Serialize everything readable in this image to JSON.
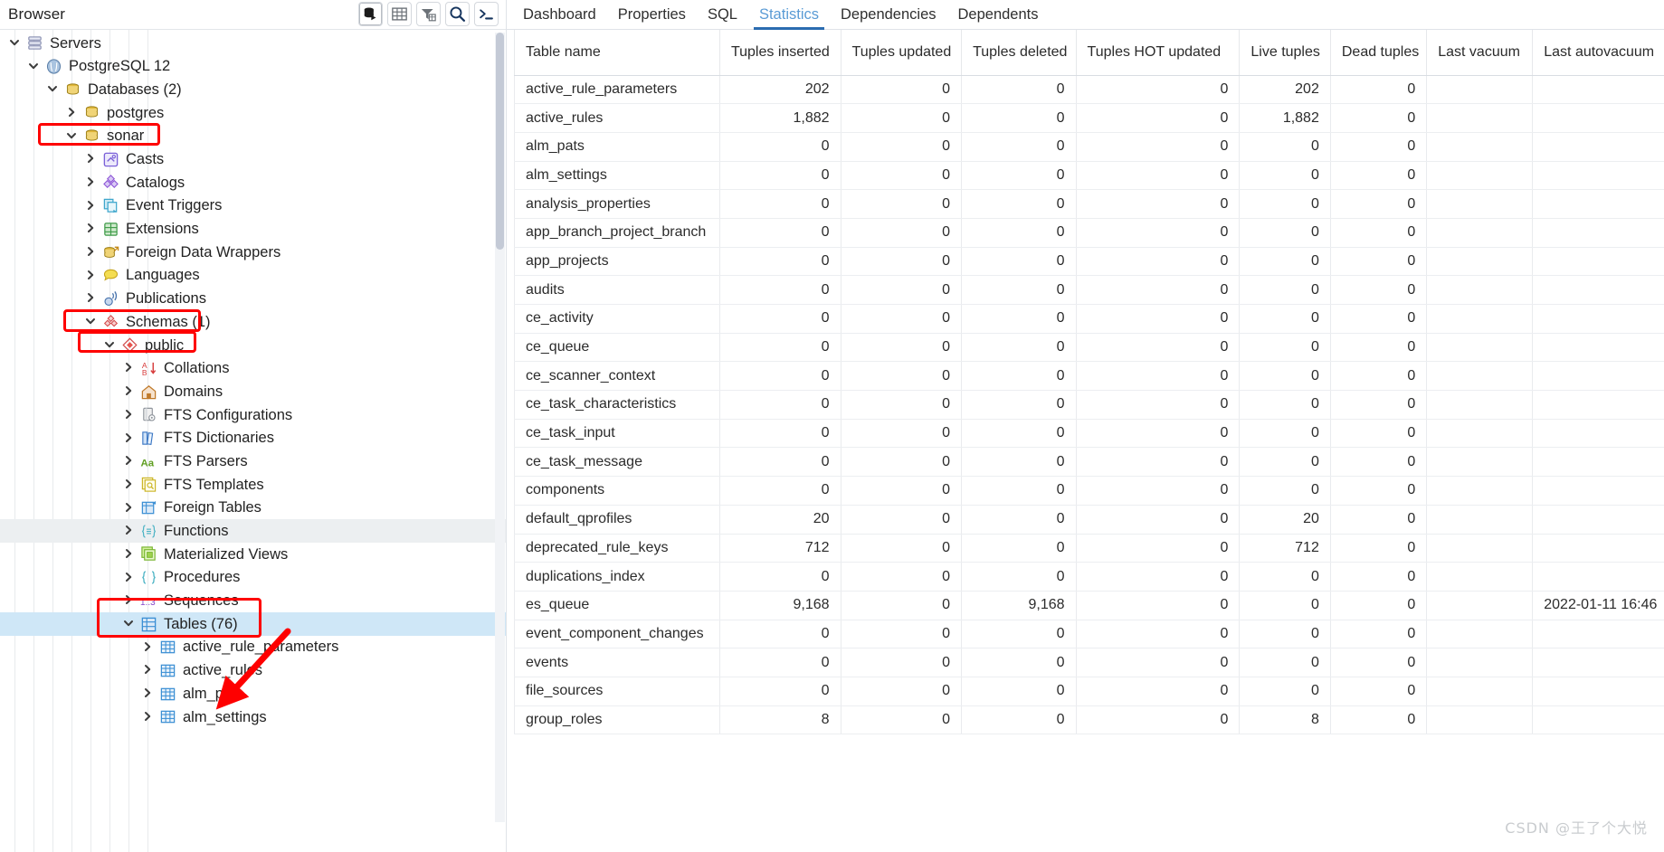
{
  "browser": {
    "title": "Browser",
    "tools": [
      {
        "name": "query-tool-icon",
        "label": "Query Tool"
      },
      {
        "name": "view-data-icon",
        "label": "View Data"
      },
      {
        "name": "filtered-rows-icon",
        "label": "Filtered Rows"
      },
      {
        "name": "search-icon",
        "label": "Search Objects"
      },
      {
        "name": "psql-terminal-icon",
        "label": "PSQL Tool"
      }
    ]
  },
  "tree": [
    {
      "label": "Servers",
      "indent": 0,
      "state": "open",
      "icon": "servers-icon",
      "state_css": "",
      "highlight": false
    },
    {
      "label": "PostgreSQL 12",
      "indent": 1,
      "state": "open",
      "icon": "postgres-icon",
      "state_css": "",
      "highlight": false
    },
    {
      "label": "Databases (2)",
      "indent": 2,
      "state": "open",
      "icon": "database-group-icon",
      "state_css": "",
      "highlight": false
    },
    {
      "label": "postgres",
      "indent": 3,
      "state": "closed",
      "icon": "database-icon",
      "state_css": "",
      "highlight": false
    },
    {
      "label": "sonar",
      "indent": 3,
      "state": "open",
      "icon": "database-icon",
      "state_css": "",
      "highlight": true
    },
    {
      "label": "Casts",
      "indent": 4,
      "state": "closed",
      "icon": "casts-icon",
      "state_css": "",
      "highlight": false
    },
    {
      "label": "Catalogs",
      "indent": 4,
      "state": "closed",
      "icon": "catalogs-icon",
      "state_css": "",
      "highlight": false
    },
    {
      "label": "Event Triggers",
      "indent": 4,
      "state": "closed",
      "icon": "event-triggers-icon",
      "state_css": "",
      "highlight": false
    },
    {
      "label": "Extensions",
      "indent": 4,
      "state": "closed",
      "icon": "extensions-icon",
      "state_css": "",
      "highlight": false
    },
    {
      "label": "Foreign Data Wrappers",
      "indent": 4,
      "state": "closed",
      "icon": "fdw-icon",
      "state_css": "",
      "highlight": false
    },
    {
      "label": "Languages",
      "indent": 4,
      "state": "closed",
      "icon": "languages-icon",
      "state_css": "",
      "highlight": false
    },
    {
      "label": "Publications",
      "indent": 4,
      "state": "closed",
      "icon": "publications-icon",
      "state_css": "",
      "highlight": false
    },
    {
      "label": "Schemas (1)",
      "indent": 4,
      "state": "open",
      "icon": "schemas-icon",
      "state_css": "",
      "highlight": true
    },
    {
      "label": "public",
      "indent": 5,
      "state": "open",
      "icon": "schema-icon",
      "state_css": "",
      "highlight": true
    },
    {
      "label": "Collations",
      "indent": 6,
      "state": "closed",
      "icon": "collations-icon",
      "state_css": "",
      "highlight": false
    },
    {
      "label": "Domains",
      "indent": 6,
      "state": "closed",
      "icon": "domains-icon",
      "state_css": "",
      "highlight": false
    },
    {
      "label": "FTS Configurations",
      "indent": 6,
      "state": "closed",
      "icon": "fts-config-icon",
      "state_css": "",
      "highlight": false
    },
    {
      "label": "FTS Dictionaries",
      "indent": 6,
      "state": "closed",
      "icon": "fts-dict-icon",
      "state_css": "",
      "highlight": false
    },
    {
      "label": "FTS Parsers",
      "indent": 6,
      "state": "closed",
      "icon": "fts-parsers-icon",
      "state_css": "",
      "highlight": false
    },
    {
      "label": "FTS Templates",
      "indent": 6,
      "state": "closed",
      "icon": "fts-templates-icon",
      "state_css": "",
      "highlight": false
    },
    {
      "label": "Foreign Tables",
      "indent": 6,
      "state": "closed",
      "icon": "foreign-tables-icon",
      "state_css": "",
      "highlight": false
    },
    {
      "label": "Functions",
      "indent": 6,
      "state": "closed",
      "icon": "functions-icon",
      "state_css": "hov",
      "highlight": false
    },
    {
      "label": "Materialized Views",
      "indent": 6,
      "state": "closed",
      "icon": "matviews-icon",
      "state_css": "",
      "highlight": false
    },
    {
      "label": "Procedures",
      "indent": 6,
      "state": "closed",
      "icon": "procedures-icon",
      "state_css": "",
      "highlight": false
    },
    {
      "label": "Sequences",
      "indent": 6,
      "state": "closed",
      "icon": "sequences-icon",
      "state_css": "",
      "highlight": false
    },
    {
      "label": "Tables (76)",
      "indent": 6,
      "state": "open",
      "icon": "tables-icon",
      "state_css": "sel",
      "highlight": true
    },
    {
      "label": "active_rule_parameters",
      "indent": 7,
      "state": "closed",
      "icon": "table-icon",
      "state_css": "",
      "highlight": false
    },
    {
      "label": "active_rules",
      "indent": 7,
      "state": "closed",
      "icon": "table-icon",
      "state_css": "",
      "highlight": false
    },
    {
      "label": "alm_pats",
      "indent": 7,
      "state": "closed",
      "icon": "table-icon",
      "state_css": "",
      "highlight": false
    },
    {
      "label": "alm_settings",
      "indent": 7,
      "state": "closed",
      "icon": "table-icon",
      "state_css": "",
      "highlight": false
    }
  ],
  "tabs": [
    {
      "label": "Dashboard",
      "active": false
    },
    {
      "label": "Properties",
      "active": false
    },
    {
      "label": "SQL",
      "active": false
    },
    {
      "label": "Statistics",
      "active": true
    },
    {
      "label": "Dependencies",
      "active": false
    },
    {
      "label": "Dependents",
      "active": false
    }
  ],
  "statistics": {
    "columns": [
      "Table name",
      "Tuples inserted",
      "Tuples updated",
      "Tuples deleted",
      "Tuples HOT updated",
      "Live tuples",
      "Dead tuples",
      "Last vacuum",
      "Last autovacuum"
    ],
    "rows": [
      [
        "active_rule_parameters",
        "202",
        "0",
        "0",
        "0",
        "202",
        "0",
        "",
        ""
      ],
      [
        "active_rules",
        "1,882",
        "0",
        "0",
        "0",
        "1,882",
        "0",
        "",
        ""
      ],
      [
        "alm_pats",
        "0",
        "0",
        "0",
        "0",
        "0",
        "0",
        "",
        ""
      ],
      [
        "alm_settings",
        "0",
        "0",
        "0",
        "0",
        "0",
        "0",
        "",
        ""
      ],
      [
        "analysis_properties",
        "0",
        "0",
        "0",
        "0",
        "0",
        "0",
        "",
        ""
      ],
      [
        "app_branch_project_branch",
        "0",
        "0",
        "0",
        "0",
        "0",
        "0",
        "",
        ""
      ],
      [
        "app_projects",
        "0",
        "0",
        "0",
        "0",
        "0",
        "0",
        "",
        ""
      ],
      [
        "audits",
        "0",
        "0",
        "0",
        "0",
        "0",
        "0",
        "",
        ""
      ],
      [
        "ce_activity",
        "0",
        "0",
        "0",
        "0",
        "0",
        "0",
        "",
        ""
      ],
      [
        "ce_queue",
        "0",
        "0",
        "0",
        "0",
        "0",
        "0",
        "",
        ""
      ],
      [
        "ce_scanner_context",
        "0",
        "0",
        "0",
        "0",
        "0",
        "0",
        "",
        ""
      ],
      [
        "ce_task_characteristics",
        "0",
        "0",
        "0",
        "0",
        "0",
        "0",
        "",
        ""
      ],
      [
        "ce_task_input",
        "0",
        "0",
        "0",
        "0",
        "0",
        "0",
        "",
        ""
      ],
      [
        "ce_task_message",
        "0",
        "0",
        "0",
        "0",
        "0",
        "0",
        "",
        ""
      ],
      [
        "components",
        "0",
        "0",
        "0",
        "0",
        "0",
        "0",
        "",
        ""
      ],
      [
        "default_qprofiles",
        "20",
        "0",
        "0",
        "0",
        "20",
        "0",
        "",
        ""
      ],
      [
        "deprecated_rule_keys",
        "712",
        "0",
        "0",
        "0",
        "712",
        "0",
        "",
        ""
      ],
      [
        "duplications_index",
        "0",
        "0",
        "0",
        "0",
        "0",
        "0",
        "",
        ""
      ],
      [
        "es_queue",
        "9,168",
        "0",
        "9,168",
        "0",
        "0",
        "0",
        "",
        "2022-01-11 16:46"
      ],
      [
        "event_component_changes",
        "0",
        "0",
        "0",
        "0",
        "0",
        "0",
        "",
        ""
      ],
      [
        "events",
        "0",
        "0",
        "0",
        "0",
        "0",
        "0",
        "",
        ""
      ],
      [
        "file_sources",
        "0",
        "0",
        "0",
        "0",
        "0",
        "0",
        "",
        ""
      ],
      [
        "group_roles",
        "8",
        "0",
        "0",
        "0",
        "8",
        "0",
        "",
        ""
      ]
    ]
  },
  "watermark": "CSDN @王了个大悦",
  "colors": {
    "accent": "#2b6cb0",
    "tab_active_text": "#5a9bd5",
    "annotation": "#fe0000",
    "selection": "#cfe7f7"
  }
}
